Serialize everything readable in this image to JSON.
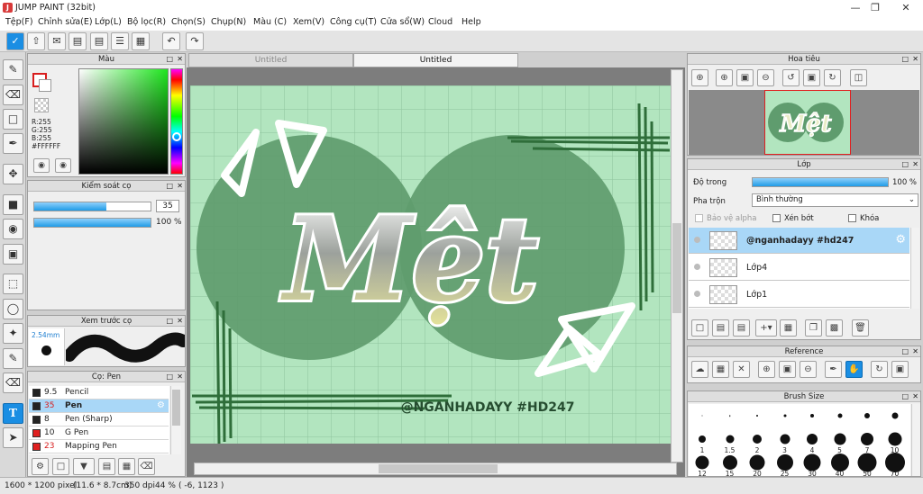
{
  "window": {
    "title": "JUMP PAINT (32bit)"
  },
  "menu": [
    "Tệp(F)",
    "Chỉnh sửa(E)",
    "Lớp(L)",
    "Bộ lọc(R)",
    "Chọn(S)",
    "Chụp(N)",
    "Màu (C)",
    "Xem(V)",
    "Công cụ(T)",
    "Cửa sổ(W)",
    "Cloud",
    "Help"
  ],
  "color_panel": {
    "title": "Màu",
    "r": "R:255",
    "g": "G:255",
    "b": "B:255",
    "hex": "#FFFFFF"
  },
  "brush_control": {
    "title": "Kiểm soát cọ",
    "size_value": "35",
    "size_fraction": 0.62,
    "opacity_label": "100 %",
    "opacity_fraction": 1.0
  },
  "brush_preview": {
    "title": "Xem trước cọ",
    "size_label": "2.54mm"
  },
  "brush_list": {
    "title": "Cọ: Pen",
    "items": [
      {
        "size": "9.5",
        "name": "Pencil",
        "color": "#222222",
        "selected": false,
        "size_red": false
      },
      {
        "size": "35",
        "name": "Pen",
        "color": "#222222",
        "selected": true,
        "size_red": true
      },
      {
        "size": "8",
        "name": "Pen (Sharp)",
        "color": "#222222",
        "selected": false,
        "size_red": false
      },
      {
        "size": "10",
        "name": "G Pen",
        "color": "#e02020",
        "selected": false,
        "size_red": false
      },
      {
        "size": "23",
        "name": "Mapping Pen",
        "color": "#e02020",
        "selected": false,
        "size_red": true
      }
    ]
  },
  "tabs": [
    {
      "label": "Untitled",
      "active": false
    },
    {
      "label": "Untitled",
      "active": true
    }
  ],
  "artwork": {
    "main_text": "Mệt",
    "handle": "@NGANHADAYY #HD247",
    "bg": "#b2e5bf",
    "circle": "#5f9c6e",
    "accent": "#e6e49a"
  },
  "navigator": {
    "title": "Hoa tiêu"
  },
  "layer_panel": {
    "title": "Lớp",
    "opacity_label": "Độ trong",
    "opacity_value": "100 %",
    "blend_label": "Pha trộn",
    "blend_value": "Bình thường",
    "protect_alpha": "Bảo vệ alpha",
    "clipping": "Xén bớt",
    "lock": "Khóa",
    "layers": [
      {
        "name": "@nganhadayy #hd247",
        "selected": true
      },
      {
        "name": "Lớp4",
        "selected": false
      },
      {
        "name": "Lớp1",
        "selected": false
      }
    ]
  },
  "reference_panel": {
    "title": "Reference"
  },
  "brush_size_panel": {
    "title": "Brush Size",
    "row1": [
      "",
      "",
      "",
      "",
      "",
      "",
      "",
      ""
    ],
    "row2": [
      "1",
      "1.5",
      "2",
      "3",
      "4",
      "5",
      "7",
      "10"
    ],
    "row3": [
      "12",
      "15",
      "20",
      "25",
      "30",
      "40",
      "50",
      "70"
    ]
  },
  "status": {
    "size": "1600 * 1200 pixel",
    "physical": "(11.6 * 8.7cm)",
    "dpi": "350 dpi",
    "zoom": "44 %",
    "coords": "( -6, 1123 )"
  }
}
